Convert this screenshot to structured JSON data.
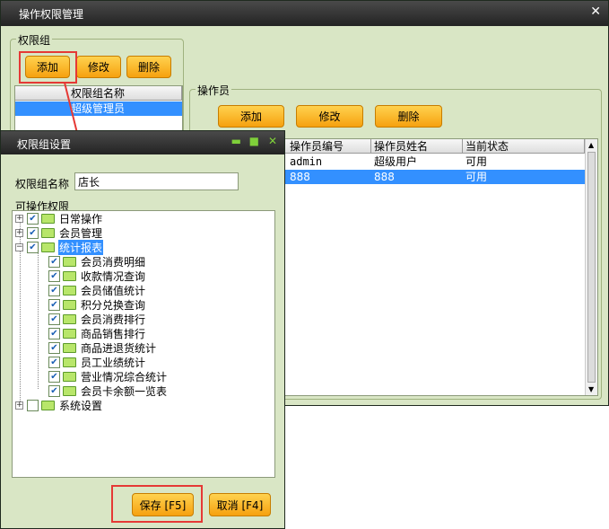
{
  "main": {
    "title": "操作权限管理",
    "close_glyph": "✕",
    "perm_group": {
      "label": "权限组",
      "add": "添加",
      "edit": "修改",
      "del": "删除",
      "col_name": "权限组名称",
      "rows": [
        "超级管理员"
      ]
    },
    "operator": {
      "label": "操作员",
      "add": "添加",
      "edit": "修改",
      "del": "删除",
      "columns": [
        "操作员编号",
        "操作员姓名",
        "当前状态"
      ],
      "rows": [
        {
          "id": "admin",
          "name": "超级用户",
          "status": "可用"
        },
        {
          "id": "888",
          "name": "888",
          "status": "可用"
        }
      ]
    }
  },
  "dialog": {
    "title": "权限组设置",
    "name_label": "权限组名称",
    "name_value": "店长",
    "perm_label": "可操作权限",
    "tree": [
      {
        "label": "日常操作",
        "checked": true
      },
      {
        "label": "会员管理",
        "checked": true
      },
      {
        "label": "统计报表",
        "checked": true,
        "expanded": true,
        "children": [
          "会员消费明细",
          "收款情况查询",
          "会员储值统计",
          "积分兑换查询",
          "会员消费排行",
          "商品销售排行",
          "商品进退货统计",
          "员工业绩统计",
          "营业情况综合统计",
          "会员卡余额一览表"
        ]
      },
      {
        "label": "系统设置",
        "checked": false
      }
    ],
    "save": "保存 [F5]",
    "cancel": "取消 [F4]"
  }
}
